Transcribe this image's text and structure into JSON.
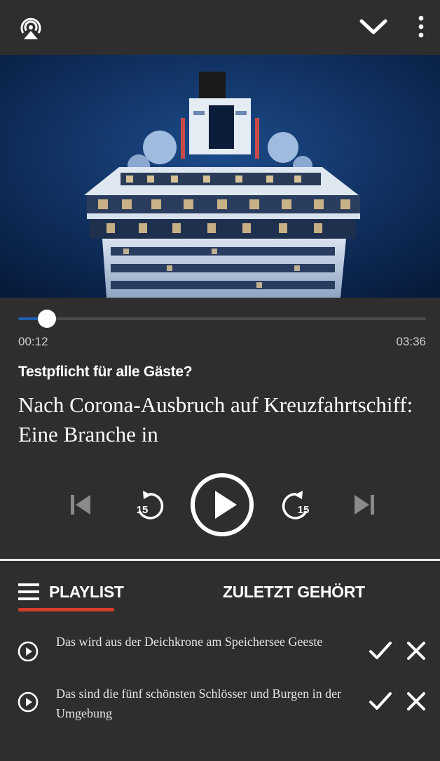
{
  "player": {
    "current_time": "00:12",
    "duration": "03:36",
    "progress_fraction": 0.07,
    "kicker": "Testpflicht für alle Gäste?",
    "headline": "Nach Corona-Ausbruch auf Kreuzfahrtschiff: Eine Branche in",
    "skip_seconds": "15"
  },
  "tabs": {
    "playlist": "PLAYLIST",
    "recent": "ZULETZT GEHÖRT"
  },
  "playlist": [
    {
      "title": "Das wird aus der Deichkrone am Speichersee Geeste"
    },
    {
      "title": "Das sind die fünf schönsten Schlösser und Burgen in der Umgebung"
    }
  ],
  "icons": {
    "airplay": "airplay-icon",
    "collapse": "chevron-down-icon",
    "menu": "more-vertical-icon",
    "previous": "skip-previous-icon",
    "rewind": "rewind-15-icon",
    "play": "play-icon",
    "forward": "forward-15-icon",
    "next": "skip-next-icon",
    "hamburger": "hamburger-icon",
    "item_play": "play-circle-icon",
    "done": "check-icon",
    "remove": "close-icon"
  },
  "colors": {
    "background": "#2e2e2e",
    "progress_fill": "#1d5fae",
    "tab_underline": "#d53b28"
  }
}
